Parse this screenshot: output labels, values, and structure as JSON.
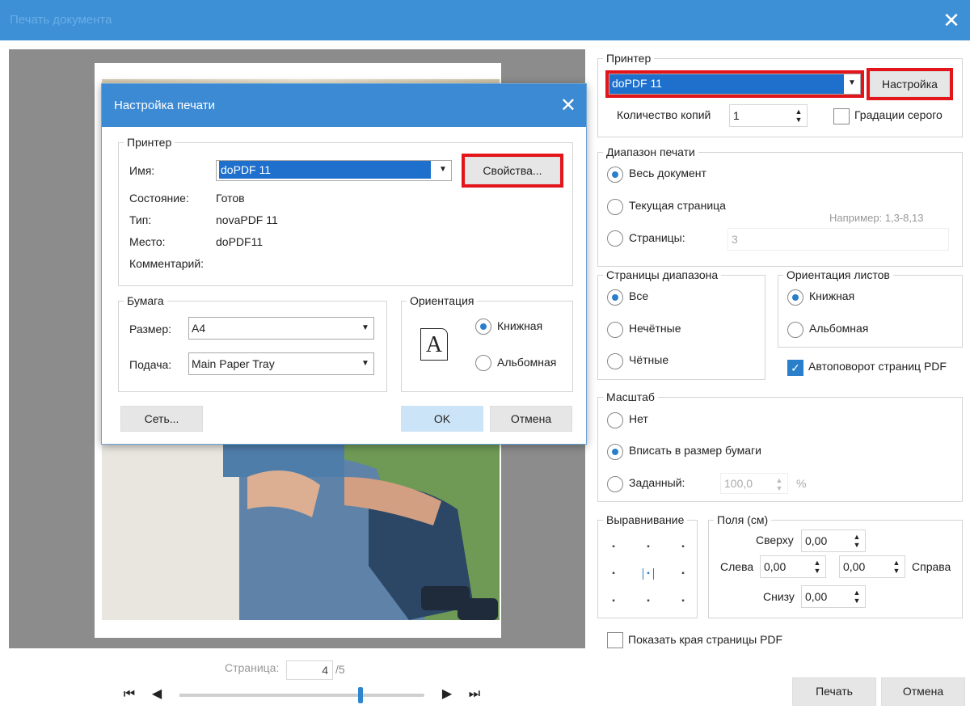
{
  "window": {
    "title": "Печать документа",
    "close_icon": "close-icon"
  },
  "printer": {
    "group": "Принтер",
    "name": "doPDF 11",
    "setup_button": "Настройка",
    "copies_label": "Количество копий",
    "copies_value": "1",
    "grayscale_label": "Градации серого"
  },
  "range": {
    "group": "Диапазон печати",
    "all": "Весь документ",
    "current": "Текущая страница",
    "pages": "Страницы:",
    "pages_value": "3",
    "hint": "Например: 1,3-8,13"
  },
  "subset": {
    "group": "Страницы диапазона",
    "all": "Все",
    "odd": "Нечётные",
    "even": "Чётные"
  },
  "orientation": {
    "group": "Ориентация листов",
    "portrait": "Книжная",
    "landscape": "Альбомная",
    "autorotate": "Автоповорот страниц PDF"
  },
  "scale": {
    "group": "Масштаб",
    "none": "Нет",
    "fit": "Вписать в размер бумаги",
    "custom": "Заданный:",
    "custom_value": "100,0",
    "percent": "%"
  },
  "align": {
    "group": "Выравнивание"
  },
  "margins": {
    "group": "Поля (см)",
    "top_label": "Сверху",
    "top": "0,00",
    "left_label": "Слева",
    "left": "0,00",
    "right_label": "Справа",
    "right": "0,00",
    "bottom_label": "Снизу",
    "bottom": "0,00"
  },
  "show_edges": "Показать края страницы PDF",
  "actions": {
    "print": "Печать",
    "cancel": "Отмена"
  },
  "pager": {
    "label": "Страница:",
    "current": "4",
    "total": "/5",
    "progress": 0.74
  },
  "dialog": {
    "title": "Настройка печати",
    "printer_group": "Принтер",
    "name_label": "Имя:",
    "name_value": "doPDF 11",
    "properties_button": "Свойства...",
    "status_label": "Состояние:",
    "status_value": "Готов",
    "type_label": "Тип:",
    "type_value": "novaPDF 11",
    "where_label": "Место:",
    "where_value": "doPDF11",
    "comment_label": "Комментарий:",
    "paper_group": "Бумага",
    "size_label": "Размер:",
    "size_value": "A4",
    "source_label": "Подача:",
    "source_value": "Main Paper Tray",
    "orient_group": "Ориентация",
    "portrait": "Книжная",
    "landscape": "Альбомная",
    "orient_icon_letter": "A",
    "network_button": "Сеть...",
    "ok_button": "OK",
    "cancel_button": "Отмена"
  }
}
